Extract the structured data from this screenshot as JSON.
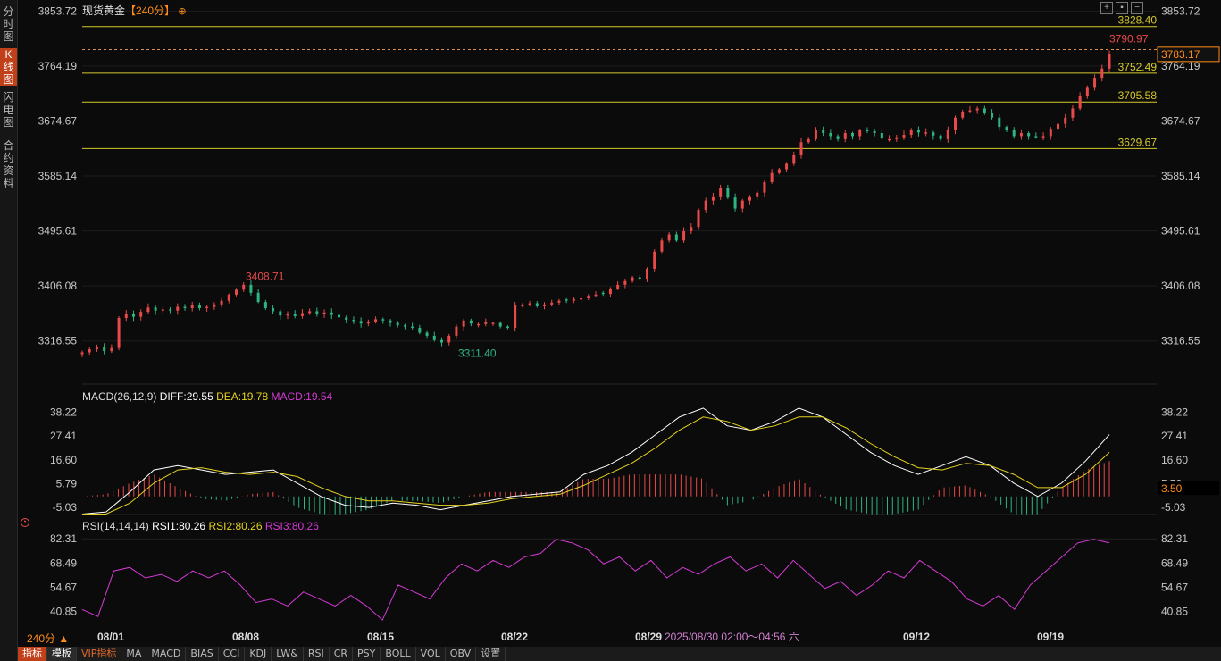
{
  "sidebar": [
    {
      "label": "分时图",
      "active": false
    },
    {
      "label": "K线图",
      "active": true
    },
    {
      "label": "闪电图",
      "active": false
    },
    {
      "label": "合约资料",
      "active": false
    }
  ],
  "header": {
    "symbol": "现货黄金",
    "period_label": "【240分】",
    "add_icon": "plus-circle-icon"
  },
  "toolbar_icons": [
    "expand-icon",
    "settings-icon",
    "shrink-icon"
  ],
  "price_axis": {
    "ticks": [
      "3853.72",
      "3764.19",
      "3674.67",
      "3585.14",
      "3495.61",
      "3406.08",
      "3316.55"
    ],
    "last_price": "3783.17"
  },
  "annotations": {
    "levels": [
      "3828.40",
      "3752.49",
      "3705.58",
      "3629.67"
    ],
    "high_label": "3790.97",
    "chart_high_label": "3408.71",
    "chart_low_label": "3311.40"
  },
  "macd": {
    "title": "MACD(26,12,9)",
    "diff_label": "DIFF:29.55",
    "dea_label": "DEA:19.78",
    "macd_label": "MACD:19.54",
    "ticks": [
      "38.22",
      "27.41",
      "16.60",
      "5.79",
      "-5.03"
    ],
    "current": "3.50"
  },
  "rsi": {
    "title": "RSI(14,14,14)",
    "rsi1_label": "RSI1:80.26",
    "rsi2_label": "RSI2:80.26",
    "rsi3_label": "RSI3:80.26",
    "ticks": [
      "82.31",
      "68.49",
      "54.67",
      "40.85"
    ]
  },
  "time_axis": {
    "period_button": "240分 ▲",
    "dates": [
      "08/01",
      "08/08",
      "08/15",
      "08/22",
      "08/29",
      "09/12",
      "09/19"
    ],
    "cursor_label": "2025/08/30 02:00～04:56 六"
  },
  "bottom_bar": [
    "指标",
    "模板",
    "VIP指标",
    "MA",
    "MACD",
    "BIAS",
    "CCI",
    "KDJ",
    "LW&",
    "RSI",
    "CR",
    "PSY",
    "BOLL",
    "VOL",
    "OBV",
    "设置"
  ],
  "colors": {
    "up": "#e84a4a",
    "down": "#2fb582",
    "level_line": "#d6c92c",
    "diff_line": "#ffffff",
    "dea_line": "#e6d31f",
    "rsi_line": "#d63ad6",
    "accent": "#ff8c1a"
  },
  "chart_data": [
    {
      "type": "candlestick",
      "title": "现货黄金【240分】",
      "ylim": [
        3290,
        3860
      ],
      "x": [
        "08/01",
        "08/08",
        "08/15",
        "08/22",
        "08/29",
        "09/12",
        "09/19"
      ],
      "close_path": [
        3298,
        3303,
        3306,
        3300,
        3305,
        3354,
        3360,
        3356,
        3364,
        3371,
        3366,
        3368,
        3366,
        3372,
        3370,
        3375,
        3370,
        3372,
        3376,
        3382,
        3392,
        3400,
        3408,
        3395,
        3380,
        3370,
        3365,
        3358,
        3360,
        3357,
        3362,
        3365,
        3361,
        3363,
        3359,
        3355,
        3351,
        3349,
        3345,
        3348,
        3352,
        3350,
        3346,
        3342,
        3340,
        3338,
        3330,
        3325,
        3318,
        3314,
        3325,
        3340,
        3350,
        3345,
        3344,
        3347,
        3346,
        3340,
        3338,
        3375,
        3375,
        3378,
        3373,
        3376,
        3379,
        3382,
        3382,
        3385,
        3386,
        3390,
        3392,
        3393,
        3402,
        3408,
        3414,
        3420,
        3418,
        3434,
        3462,
        3480,
        3490,
        3480,
        3495,
        3502,
        3530,
        3545,
        3552,
        3565,
        3550,
        3532,
        3545,
        3552,
        3558,
        3575,
        3590,
        3596,
        3605,
        3620,
        3640,
        3645,
        3660,
        3655,
        3650,
        3645,
        3655,
        3650,
        3660,
        3658,
        3655,
        3646,
        3645,
        3648,
        3652,
        3660,
        3656,
        3656,
        3651,
        3645,
        3660,
        3680,
        3690,
        3692,
        3695,
        3688,
        3680,
        3665,
        3660,
        3650,
        3655,
        3650,
        3648,
        3650,
        3662,
        3670,
        3680,
        3695,
        3715,
        3730,
        3745,
        3760,
        3783
      ],
      "high": 3790.97,
      "low": 3311.4,
      "last": 3783.17,
      "horizontal_levels": [
        3828.4,
        3752.49,
        3705.58,
        3629.67
      ]
    },
    {
      "type": "line",
      "title": "MACD(26,12,9)",
      "ylim": [
        -9,
        42
      ],
      "series": [
        {
          "name": "DIFF",
          "values": [
            -8,
            -7,
            2,
            12,
            14,
            12,
            10,
            11,
            12,
            6,
            0,
            -4,
            -5,
            -3,
            -4,
            -6,
            -4,
            -2,
            0,
            1,
            2,
            10,
            14,
            20,
            28,
            36,
            40,
            32,
            30,
            34,
            40,
            36,
            28,
            20,
            14,
            10,
            14,
            18,
            14,
            6,
            0,
            6,
            16,
            28
          ]
        },
        {
          "name": "DEA",
          "values": [
            -8,
            -8,
            -3,
            6,
            12,
            13,
            11,
            10,
            11,
            9,
            4,
            0,
            -2,
            -2,
            -3,
            -4,
            -4,
            -3,
            -1,
            0,
            1,
            5,
            10,
            15,
            22,
            30,
            36,
            34,
            30,
            32,
            36,
            36,
            31,
            24,
            18,
            13,
            12,
            15,
            14,
            10,
            4,
            4,
            10,
            20
          ]
        },
        {
          "name": "MACD",
          "values": [
            0,
            1,
            6,
            10,
            4,
            -1,
            -2,
            1,
            2,
            -5,
            -8,
            -8,
            -6,
            -2,
            -2,
            -3,
            0,
            2,
            2,
            2,
            2,
            8,
            8,
            10,
            10,
            10,
            8,
            -4,
            -2,
            4,
            8,
            0,
            -6,
            -8,
            -8,
            -6,
            4,
            5,
            0,
            -8,
            -8,
            4,
            12,
            16
          ]
        }
      ],
      "last": 3.5
    },
    {
      "type": "line",
      "title": "RSI(14,14,14)",
      "ylim": [
        33,
        86
      ],
      "series": [
        {
          "name": "RSI1",
          "values": [
            42,
            38,
            64,
            66,
            60,
            62,
            58,
            64,
            60,
            64,
            56,
            46,
            48,
            44,
            52,
            48,
            44,
            50,
            44,
            36,
            56,
            52,
            48,
            60,
            68,
            64,
            70,
            66,
            72,
            74,
            82,
            80,
            76,
            68,
            72,
            64,
            70,
            60,
            66,
            62,
            68,
            72,
            64,
            68,
            60,
            70,
            62,
            54,
            58,
            50,
            56,
            64,
            60,
            70,
            64,
            58,
            48,
            44,
            50,
            42,
            56,
            64,
            72,
            80,
            82,
            80
          ]
        }
      ]
    }
  ]
}
